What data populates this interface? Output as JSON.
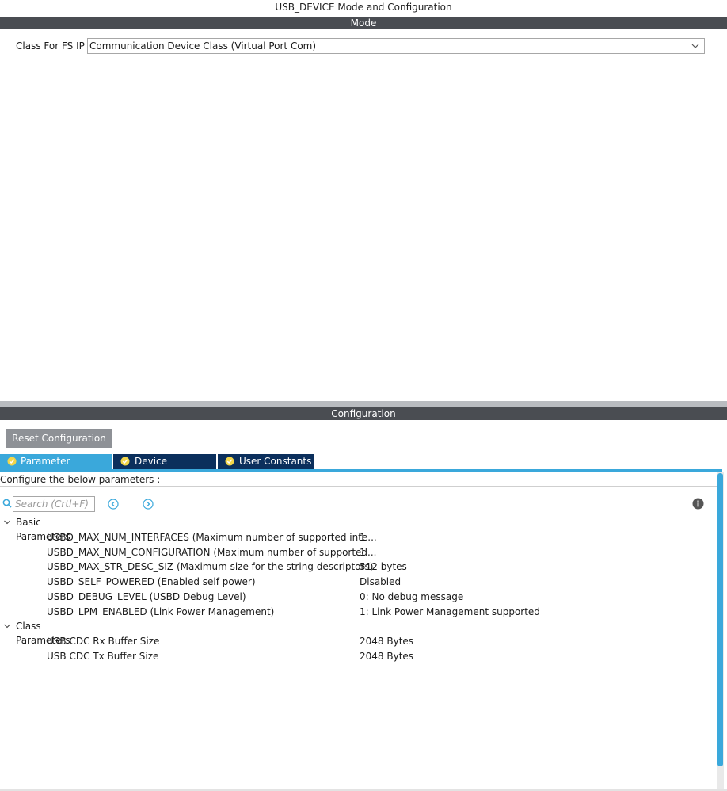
{
  "window": {
    "title": "USB_DEVICE Mode and Configuration"
  },
  "mode": {
    "header": "Mode",
    "class_label": "Class For FS IP",
    "class_value": "Communication Device Class (Virtual Port Com)"
  },
  "config": {
    "header": "Configuration",
    "reset_label": "Reset Configuration",
    "tabs": [
      {
        "label": "Parameter Settings"
      },
      {
        "label": "Device Descriptor"
      },
      {
        "label": "User Constants"
      }
    ],
    "hint": "Configure the below parameters :",
    "search_placeholder": "Search (Crtl+F)",
    "groups": [
      {
        "name": "Basic Parameters",
        "params": [
          {
            "name": "USBD_MAX_NUM_INTERFACES (Maximum number of supported inte...",
            "value": "1"
          },
          {
            "name": "USBD_MAX_NUM_CONFIGURATION (Maximum number of supported...",
            "value": "1"
          },
          {
            "name": "USBD_MAX_STR_DESC_SIZ (Maximum size for the string descriptors)",
            "value": "512 bytes"
          },
          {
            "name": "USBD_SELF_POWERED (Enabled self power)",
            "value": "Disabled"
          },
          {
            "name": "USBD_DEBUG_LEVEL (USBD Debug Level)",
            "value": "0: No debug message"
          },
          {
            "name": "USBD_LPM_ENABLED (Link Power Management)",
            "value": "1: Link Power Management supported"
          }
        ]
      },
      {
        "name": "Class Parameters",
        "params": [
          {
            "name": "USB CDC Rx Buffer Size",
            "value": "2048 Bytes"
          },
          {
            "name": "USB CDC Tx Buffer Size",
            "value": "2048 Bytes"
          }
        ]
      }
    ]
  },
  "colors": {
    "tab_active": "#3aa8db",
    "tab_inactive": "#0b2f5c",
    "header_bar": "#4a4d52",
    "reset_button": "#8e9196"
  },
  "icons": [
    "chevron-down-icon",
    "check-circle-icon",
    "search-icon",
    "arrow-left-circle-icon",
    "arrow-right-circle-icon",
    "info-icon",
    "expand-chevron-icon"
  ]
}
